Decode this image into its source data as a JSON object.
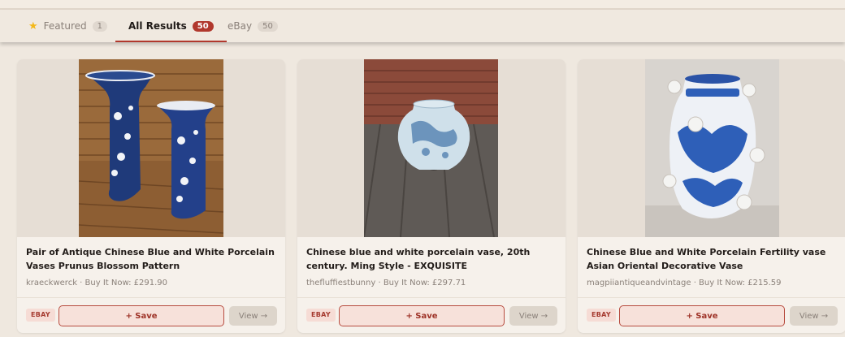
{
  "tabs": [
    {
      "label": "Featured",
      "count": "1",
      "icon": "star-icon"
    },
    {
      "label": "All Results",
      "count": "50"
    },
    {
      "label": "eBay",
      "count": "50"
    }
  ],
  "cards": [
    {
      "title": "Pair of Antique Chinese Blue and White Porcelain Vases Prunus Blossom Pattern",
      "meta": "kraeckwerck · Buy It Now: £291.90",
      "source": "EBAY",
      "save_label": "+ Save",
      "view_label": "View →"
    },
    {
      "title": "Chinese blue and white porcelain vase, 20th century. Ming Style - EXQUISITE",
      "meta": "thefluffiestbunny · Buy It Now: £297.71",
      "source": "EBAY",
      "save_label": "+ Save",
      "view_label": "View →"
    },
    {
      "title": "Chinese Blue and White Porcelain Fertility vase Asian Oriental Decorative Vase",
      "meta": "magpiiantiqueandvintage · Buy It Now: £215.59",
      "source": "EBAY",
      "save_label": "+ Save",
      "view_label": "View →"
    }
  ],
  "colors": {
    "accent": "#b1382d",
    "background": "#efe8df",
    "card": "#f6f1eb"
  }
}
